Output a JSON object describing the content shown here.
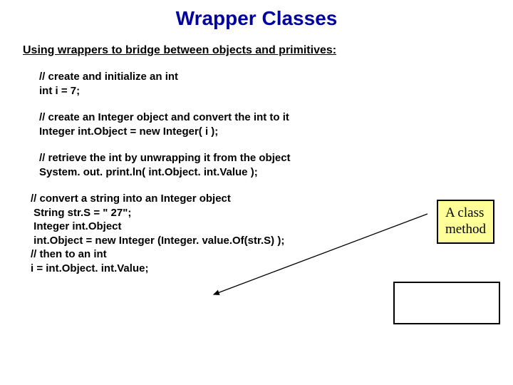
{
  "title": "Wrapper Classes",
  "subtitle": "Using wrappers to bridge between objects and primitives:",
  "block1": {
    "l1": "// create and initialize an int",
    "l2": "int i = 7;"
  },
  "block2": {
    "l1": "// create an Integer object and convert the int to it",
    "l2": "Integer int.Object = new Integer( i );"
  },
  "block3": {
    "l1": "// retrieve the int by unwrapping it from the object",
    "l2": "System. out. print.ln( int.Object. int.Value );"
  },
  "block4": {
    "l1": "// convert a string into an Integer object",
    "l2": " String str.S = \" 27\";",
    "l3": " Integer int.Object",
    "l4": " int.Object = new Integer (Integer. value.Of(str.S) );",
    "l5": "// then to an int",
    "l6": "i = int.Object. int.Value;"
  },
  "callout": {
    "l1": "A class",
    "l2": "method"
  }
}
